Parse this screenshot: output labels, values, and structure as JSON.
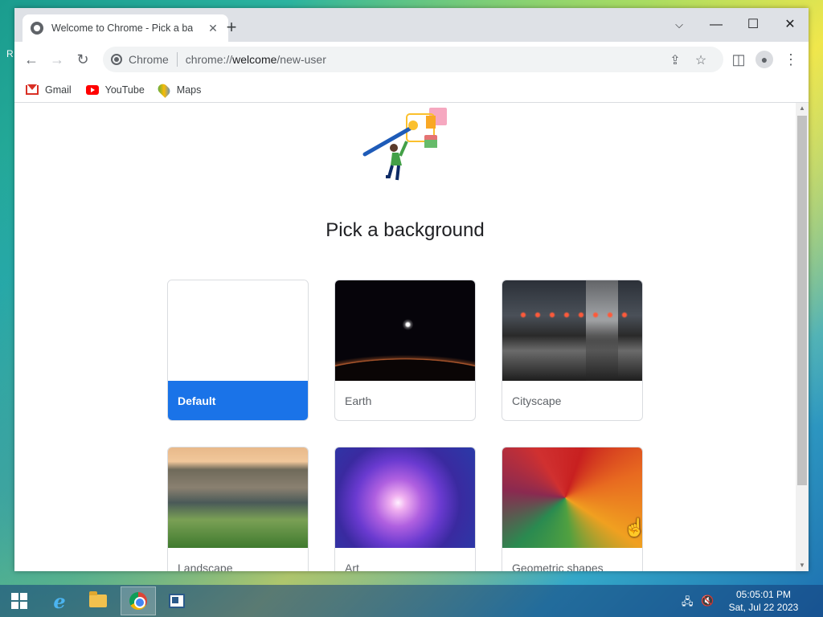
{
  "desktop": {
    "corner_text": "R"
  },
  "tab": {
    "title": "Welcome to Chrome - Pick a bac",
    "close": "✕"
  },
  "new_tab": "+",
  "window_controls": {
    "list": "⌵",
    "minimize": "—",
    "maximize": "☐",
    "close": "✕"
  },
  "toolbar": {
    "back": "←",
    "forward": "→",
    "reload": "↻",
    "omnibox_label": "Chrome",
    "url_prefix": "chrome://",
    "url_host": "welcome",
    "url_path": "/new-user",
    "share": "⇪",
    "bookmark": "☆",
    "side_panel": "◫",
    "profile": "●",
    "menu": "⋮"
  },
  "bookmarks": [
    {
      "label": "Gmail",
      "icon": "gmail-icon"
    },
    {
      "label": "YouTube",
      "icon": "youtube-icon"
    },
    {
      "label": "Maps",
      "icon": "maps-icon"
    }
  ],
  "page": {
    "heading": "Pick a background",
    "cards": [
      {
        "label": "Default",
        "selected": true
      },
      {
        "label": "Earth",
        "selected": false
      },
      {
        "label": "Cityscape",
        "selected": false
      },
      {
        "label": "Landscape",
        "selected": false
      },
      {
        "label": "Art",
        "selected": false
      },
      {
        "label": "Geometric shapes",
        "selected": false
      }
    ]
  },
  "colors": {
    "accent": "#1a73e8",
    "titlebar": "#dee1e6"
  },
  "taskbar": {
    "clock_time": "05:05:01 PM",
    "clock_date": "Sat, Jul 22 2023"
  }
}
